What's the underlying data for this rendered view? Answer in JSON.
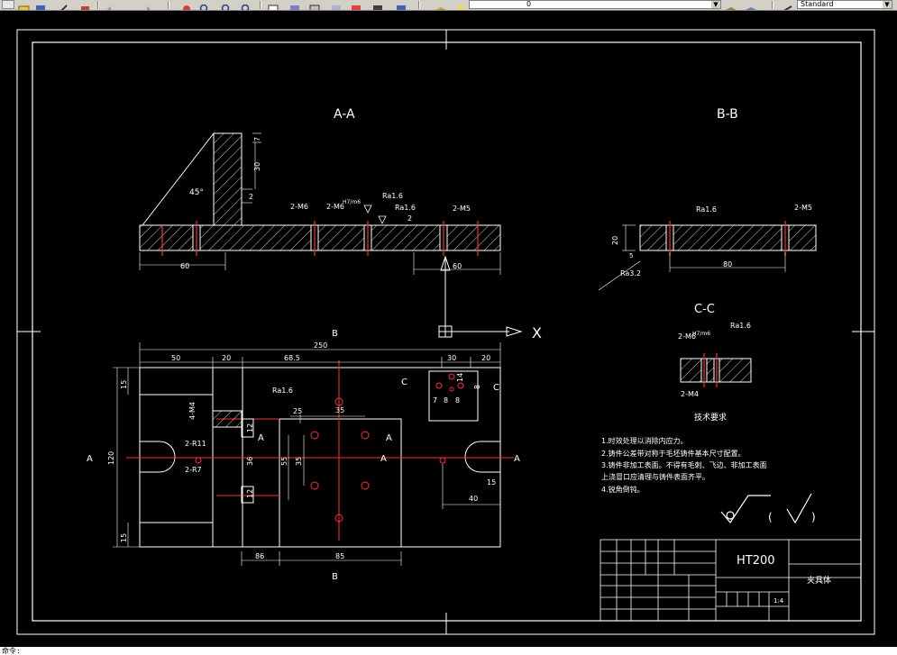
{
  "toolbar": {
    "layer_value": "0",
    "textstyle_value": "Standard"
  },
  "drawing": {
    "views": {
      "section_aa": "A-A",
      "section_bb": "B-B",
      "section_cc": "C-C",
      "main_marker_b_top": "B",
      "main_marker_b_bottom": "B",
      "marker_a_left": "A",
      "marker_a_right": "A",
      "marker_a_inner_left": "A",
      "marker_a_inner_right": "A",
      "marker_a_center": "A",
      "marker_c_left": "C",
      "marker_c_right": "C"
    },
    "axis": {
      "x_label": "X"
    },
    "section_aa_dims": {
      "angle": "45°",
      "d30": "30",
      "d7": "7",
      "d2": "2",
      "thread1": "2-M6",
      "thread2": "2-M6",
      "tol": "H7/m6",
      "rough1": "Ra1.6",
      "rough2": "Ra1.6",
      "d2b": "2",
      "thread3": "2-M5",
      "d60a": "60",
      "d60b": "60"
    },
    "section_bb_dims": {
      "rough": "Ra1.6",
      "thread": "2-M5",
      "d20": "20",
      "d5": "5",
      "d80": "80",
      "rough_bottom": "Ra3.2"
    },
    "section_cc_dims": {
      "rough": "Ra1.6",
      "thread_top": "2-M6",
      "tol": "H7/m6",
      "thread_bottom": "2-M4",
      "caption": "技术要求"
    },
    "main_dims": {
      "d250": "250",
      "d50": "50",
      "d20a": "20",
      "d68_5": "68.5",
      "d30": "30",
      "d20b": "20",
      "d15a": "15",
      "d120": "120",
      "d15b": "15",
      "m4": "4-M4",
      "rough": "Ra1.6",
      "r11": "2-R11",
      "r7": "2-R7",
      "d25": "25",
      "d35": "35",
      "d12a": "12",
      "d36": "36",
      "d55": "55",
      "d35b": "35",
      "d12b": "12",
      "d86": "86",
      "d85": "85",
      "d40": "40",
      "d15c": "15",
      "d7": "7",
      "d8a": "8",
      "d8b": "8",
      "d8c": "8",
      "d14": "14"
    },
    "notes": [
      "1.时效处理以消除内应力。",
      "2.铸件公差带对称于毛坯铸件基本尺寸配置。",
      "3.铸件非加工表面。不得有毛刺、飞边、非加工表面",
      "上浇冒口应清理与铸件表面齐平。",
      "4.锐角倒钝。"
    ],
    "surface_symbol_paren_left": "(",
    "surface_symbol_paren_right": ")",
    "title_block": {
      "material": "HT200",
      "part_name": "夹具体",
      "scale": "1:4"
    }
  },
  "command_line": "命令:"
}
